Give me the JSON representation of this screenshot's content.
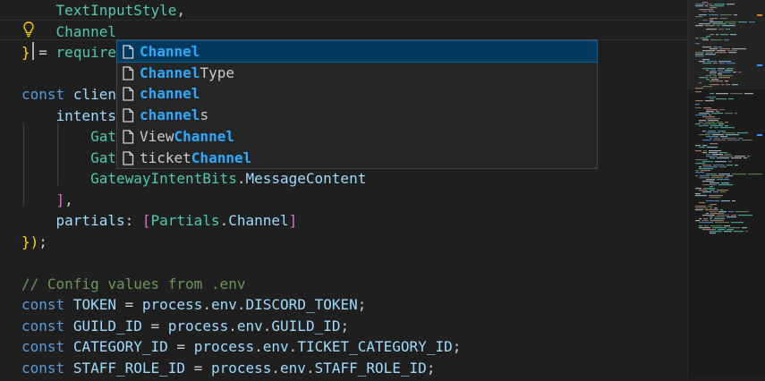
{
  "editor": {
    "lines": [
      {
        "segments": [
          {
            "t": "    "
          },
          {
            "t": "TextInputStyle",
            "c": "ty"
          },
          {
            "t": ","
          }
        ]
      },
      {
        "segments": [
          {
            "t": "    "
          },
          {
            "t": "Channel",
            "c": "ty"
          }
        ]
      },
      {
        "segments": [
          {
            "t": "}",
            "c": "yl"
          },
          {
            "t": " = "
          },
          {
            "t": "require",
            "c": "ty"
          }
        ]
      },
      {
        "segments": []
      },
      {
        "segments": [
          {
            "t": "const",
            "c": "kw"
          },
          {
            "t": " "
          },
          {
            "t": "clien",
            "c": "var"
          }
        ]
      },
      {
        "segments": [
          {
            "t": "    "
          },
          {
            "t": "intents",
            "c": "var"
          }
        ]
      },
      {
        "segments": [
          {
            "t": "        "
          },
          {
            "t": "Gat",
            "c": "ty"
          }
        ]
      },
      {
        "segments": [
          {
            "t": "        "
          },
          {
            "t": "Gat",
            "c": "ty"
          }
        ]
      },
      {
        "segments": [
          {
            "t": "        "
          },
          {
            "t": "GatewayIntentBits",
            "c": "ty"
          },
          {
            "t": "."
          },
          {
            "t": "MessageContent",
            "c": "var"
          }
        ]
      },
      {
        "segments": [
          {
            "t": "    "
          },
          {
            "t": "]",
            "c": "pk"
          },
          {
            "t": ","
          }
        ]
      },
      {
        "segments": [
          {
            "t": "    "
          },
          {
            "t": "partials",
            "c": "var"
          },
          {
            "t": ": "
          },
          {
            "t": "[",
            "c": "pk"
          },
          {
            "t": "Partials",
            "c": "ty"
          },
          {
            "t": "."
          },
          {
            "t": "Channel",
            "c": "var"
          },
          {
            "t": "]",
            "c": "pk"
          }
        ]
      },
      {
        "segments": [
          {
            "t": "})",
            "c": "yl"
          },
          {
            "t": ";"
          }
        ]
      },
      {
        "segments": []
      },
      {
        "segments": [
          {
            "t": "// Config values from .env",
            "c": "cm"
          }
        ]
      },
      {
        "segments": [
          {
            "t": "const",
            "c": "kw"
          },
          {
            "t": " "
          },
          {
            "t": "TOKEN",
            "c": "var"
          },
          {
            "t": " = "
          },
          {
            "t": "process",
            "c": "var"
          },
          {
            "t": "."
          },
          {
            "t": "env",
            "c": "var"
          },
          {
            "t": "."
          },
          {
            "t": "DISCORD_TOKEN",
            "c": "var"
          },
          {
            "t": ";"
          }
        ]
      },
      {
        "segments": [
          {
            "t": "const",
            "c": "kw"
          },
          {
            "t": " "
          },
          {
            "t": "GUILD_ID",
            "c": "var"
          },
          {
            "t": " = "
          },
          {
            "t": "process",
            "c": "var"
          },
          {
            "t": "."
          },
          {
            "t": "env",
            "c": "var"
          },
          {
            "t": "."
          },
          {
            "t": "GUILD_ID",
            "c": "var"
          },
          {
            "t": ";"
          }
        ]
      },
      {
        "segments": [
          {
            "t": "const",
            "c": "kw"
          },
          {
            "t": " "
          },
          {
            "t": "CATEGORY_ID",
            "c": "var"
          },
          {
            "t": " = "
          },
          {
            "t": "process",
            "c": "var"
          },
          {
            "t": "."
          },
          {
            "t": "env",
            "c": "var"
          },
          {
            "t": "."
          },
          {
            "t": "TICKET_CATEGORY_ID",
            "c": "var"
          },
          {
            "t": ";"
          }
        ]
      },
      {
        "segments": [
          {
            "t": "const",
            "c": "kw"
          },
          {
            "t": " "
          },
          {
            "t": "STAFF_ROLE_ID",
            "c": "var"
          },
          {
            "t": " = "
          },
          {
            "t": "process",
            "c": "var"
          },
          {
            "t": "."
          },
          {
            "t": "env",
            "c": "var"
          },
          {
            "t": "."
          },
          {
            "t": "STAFF_ROLE_ID",
            "c": "var"
          },
          {
            "t": ";"
          }
        ]
      }
    ]
  },
  "suggest": {
    "items": [
      {
        "pre": "",
        "match": "Channel",
        "post": "",
        "selected": true
      },
      {
        "pre": "",
        "match": "Channel",
        "post": "Type"
      },
      {
        "pre": "",
        "match": "channel",
        "post": ""
      },
      {
        "pre": "",
        "match": "channel",
        "post": "s"
      },
      {
        "pre": "View",
        "match": "Channel",
        "post": ""
      },
      {
        "pre": "ticket",
        "match": "Channel",
        "post": ""
      }
    ],
    "icon": "file-icon"
  },
  "colors": {
    "background": "#1f1f1f",
    "selection": "#04395e",
    "match": "#2aaaff"
  }
}
